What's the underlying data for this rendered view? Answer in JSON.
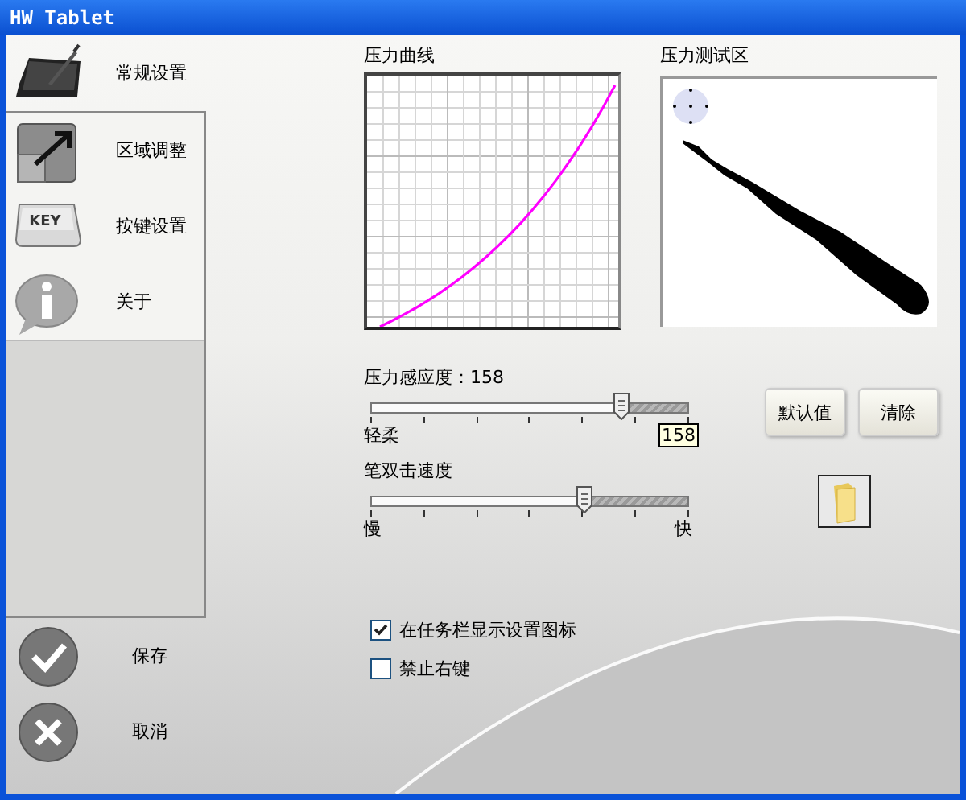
{
  "window": {
    "title": "HW Tablet"
  },
  "sidebar": {
    "items": [
      {
        "label": "常规设置",
        "kind": "tablet",
        "selected": true
      },
      {
        "label": "区域调整",
        "kind": "area",
        "selected": false
      },
      {
        "label": "按键设置",
        "kind": "key",
        "key_text": "KEY",
        "selected": false
      },
      {
        "label": "关于",
        "kind": "info",
        "selected": false
      }
    ],
    "actions": [
      {
        "label": "保存",
        "kind": "save"
      },
      {
        "label": "取消",
        "kind": "cancel"
      }
    ]
  },
  "pressure_curve": {
    "title": "压力曲线"
  },
  "test_area": {
    "title": "压力测试区"
  },
  "sliders": [
    {
      "label": "压力感应度：158",
      "level": 0.79,
      "min_label": "轻柔",
      "tooltip": "158"
    },
    {
      "label": "笔双击速度",
      "level": 0.67,
      "min_label": "慢",
      "max_label": "快"
    }
  ],
  "buttons": [
    "默认值",
    "清除"
  ],
  "checkboxes": [
    {
      "label": "在任务栏显示设置图标",
      "checked": true
    },
    {
      "label": "禁止右键",
      "checked": false
    }
  ]
}
